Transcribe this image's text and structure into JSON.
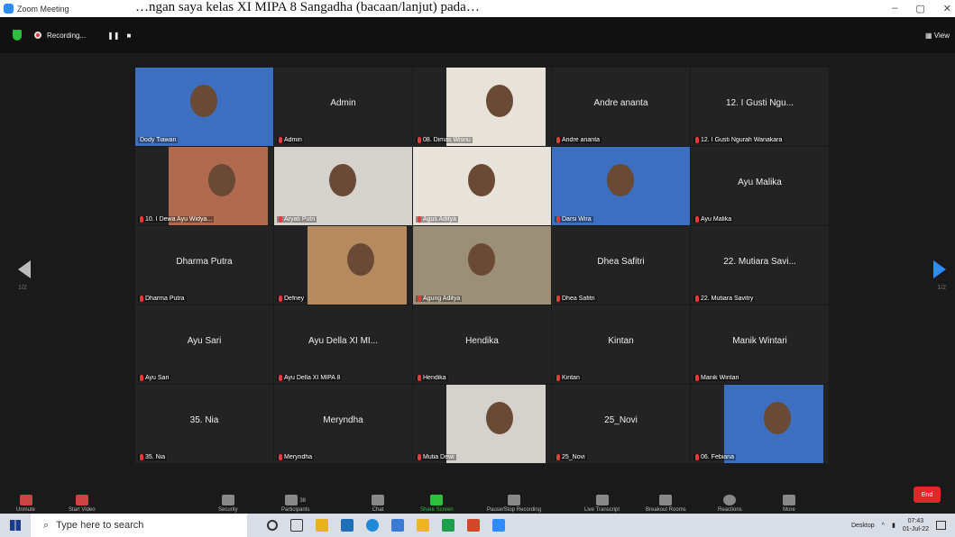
{
  "window": {
    "title": "Zoom Meeting",
    "minimize": "–",
    "maximize": "▢",
    "close": "✕"
  },
  "caption": "…ngan saya kelas XI MIPA 8 Sangadha (bacaan/lanjut) pada…",
  "topbar": {
    "recording_label": "Recording...",
    "pause": "❚❚",
    "stop": "■",
    "view_label": "▦ View"
  },
  "pager": {
    "left": "1/2",
    "right": "1/2"
  },
  "tiles": [
    {
      "name": "",
      "label": "Dody Tiawan",
      "video": true
    },
    {
      "name": "Admin",
      "label": "Admin",
      "video": false
    },
    {
      "name": "",
      "label": "08. Dimas Wisnu",
      "video": true
    },
    {
      "name": "Andre ananta",
      "label": "Andre ananta",
      "video": false
    },
    {
      "name": "12. I Gusti Ngu...",
      "label": "12. I Gusti Ngurah Wanakara",
      "video": false
    },
    {
      "name": "",
      "label": "10. I Dewa Ayu Widya...",
      "video": true
    },
    {
      "name": "",
      "label": "Aryati Putri",
      "video": true
    },
    {
      "name": "",
      "label": "Agus Aditya",
      "video": true
    },
    {
      "name": "",
      "label": "Darsi Wira",
      "video": true
    },
    {
      "name": "Ayu Malika",
      "label": "Ayu Malika",
      "video": false
    },
    {
      "name": "Dharma Putra",
      "label": "Dharma Putra",
      "video": false
    },
    {
      "name": "",
      "label": "Defney",
      "video": true
    },
    {
      "name": "",
      "label": "Agung Aditya",
      "video": true
    },
    {
      "name": "Dhea Safitri",
      "label": "Dhea Safitri",
      "video": false
    },
    {
      "name": "22. Mutiara Savi...",
      "label": "22. Mutiara Savitry",
      "video": false
    },
    {
      "name": "Ayu Sari",
      "label": "Ayu Sari",
      "video": false
    },
    {
      "name": "Ayu Della XI MI...",
      "label": "Ayu Della XI MIPA 8",
      "video": false
    },
    {
      "name": "Hendika",
      "label": "Hendika",
      "video": false
    },
    {
      "name": "Kintan",
      "label": "Kintan",
      "video": false
    },
    {
      "name": "Manik Wintari",
      "label": "Manik Wintari",
      "video": false
    },
    {
      "name": "35. Nia",
      "label": "35. Nia",
      "video": false
    },
    {
      "name": "Meryndha",
      "label": "Meryndha",
      "video": false
    },
    {
      "name": "",
      "label": "Mutia Dewi",
      "video": true
    },
    {
      "name": "25_Novi",
      "label": "25_Novi",
      "video": false
    },
    {
      "name": "",
      "label": "06. Febiana",
      "video": true
    }
  ],
  "toolbar": {
    "unmute": "Unmute",
    "start_video": "Start Video",
    "security": "Security",
    "participants": "Participants",
    "participants_count": "38",
    "chat": "Chat",
    "share_screen": "Share Screen",
    "pause_stop_recording": "Pause/Stop Recording",
    "live_transcript": "Live Transcript",
    "breakout_rooms": "Breakout Rooms",
    "reactions": "Reactions",
    "more": "More",
    "end": "End"
  },
  "taskbar": {
    "search_placeholder": "Type here to search",
    "desktop": "Desktop",
    "time": "07:43",
    "date": "01-Jul-22"
  },
  "colors": {
    "accent": "#2d8cff",
    "active_speaker": "#b9e34a",
    "end": "#e02828",
    "muted": "#e23b3b"
  }
}
